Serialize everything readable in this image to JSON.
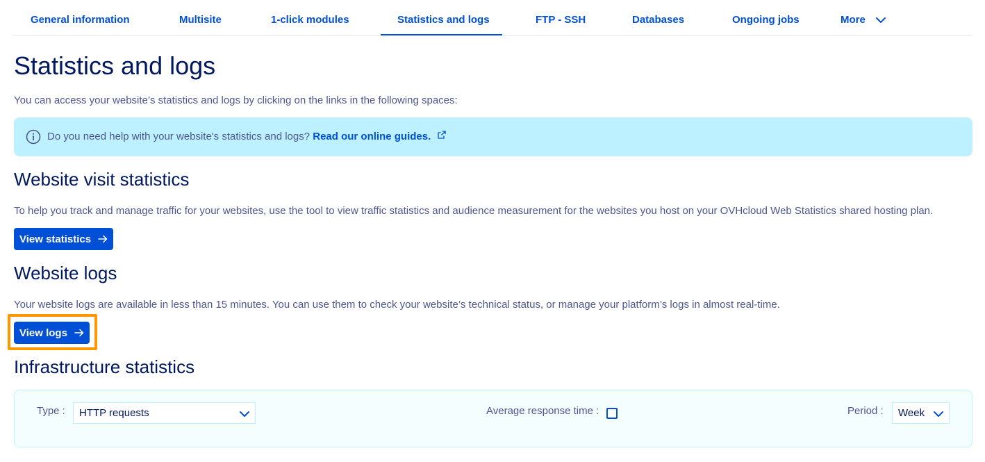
{
  "tabs": [
    {
      "label": "General information"
    },
    {
      "label": "Multisite"
    },
    {
      "label": "1-click modules"
    },
    {
      "label": "Statistics and logs",
      "active": true
    },
    {
      "label": "FTP - SSH"
    },
    {
      "label": "Databases"
    },
    {
      "label": "Ongoing jobs"
    },
    {
      "label": "More"
    }
  ],
  "page": {
    "title": "Statistics and logs",
    "intro": "You can access your website’s statistics and logs by clicking on the links in the following spaces:"
  },
  "info_banner": {
    "text": "Do you need help with your website's statistics and logs? ",
    "link_text": "Read our online guides."
  },
  "visit_stats": {
    "heading": "Website visit statistics",
    "description": "To help you track and manage traffic for your websites, use the tool to view traffic statistics and audience measurement for the websites you host on your OVHcloud Web Statistics shared hosting plan.",
    "button_label": "View statistics"
  },
  "logs": {
    "heading": "Website logs",
    "description": "Your website logs are available in less than 15 minutes. You can use them to check your website’s technical status, or manage your platform’s logs in almost real-time.",
    "button_label": "View logs"
  },
  "infra": {
    "heading": "Infrastructure statistics",
    "type_label": "Type :",
    "type_value": "HTTP requests",
    "avg_label": "Average response time :",
    "avg_checked": false,
    "period_label": "Period :",
    "period_value": "Week"
  },
  "colors": {
    "primary": "#0050d7",
    "heading": "#00185e",
    "text": "#4d5693",
    "banner_bg": "#bef1ff",
    "highlight": "#ff9800"
  },
  "icons": {
    "more_tab": "chevron-down-icon",
    "banner": "info-icon",
    "guide_link": "external-link-icon",
    "buttons": "arrow-right-icon",
    "selects": "chevron-down-icon"
  }
}
